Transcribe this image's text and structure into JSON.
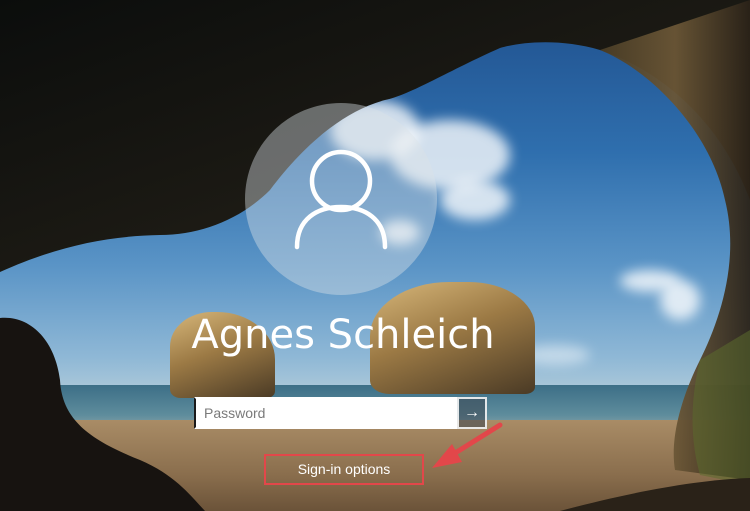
{
  "lock_screen": {
    "user": {
      "name": "Agnes Schleich",
      "avatar_icon": "user-silhouette-icon"
    },
    "password": {
      "value": "",
      "placeholder": "Password",
      "submit_icon": "arrow-right-icon",
      "submit_symbol": "→"
    },
    "sign_in_options": {
      "label": "Sign-in options"
    }
  },
  "annotation": {
    "highlight_color": "#e2474a",
    "arrow_icon": "red-arrow-icon"
  }
}
